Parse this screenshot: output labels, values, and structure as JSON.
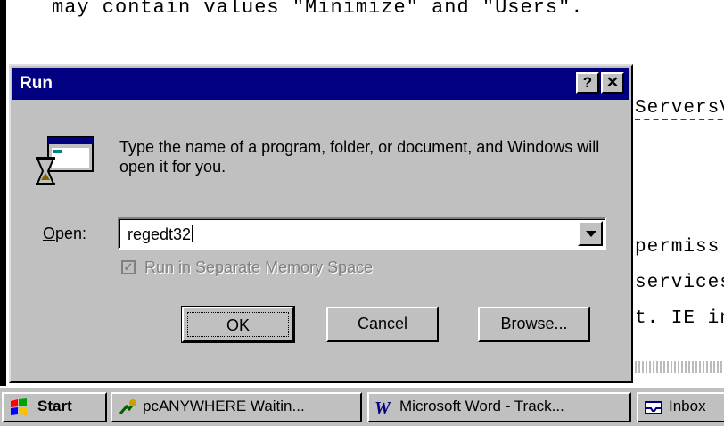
{
  "document": {
    "top_line": "may contain values \"Minimize\" and \"Users\".",
    "right_fragments": [
      "ServersV",
      "permiss",
      "services",
      "t. IE into"
    ]
  },
  "dialog": {
    "title": "Run",
    "help_button": "?",
    "close_button": "✕",
    "description": "Type the name of a program, folder, or document, and Windows will open it for you.",
    "open_label_underlined": "O",
    "open_label_rest": "pen:",
    "open_value": "regedt32",
    "checkbox_label": "Run in Separate Memory Space",
    "checkbox_checked": true,
    "checkbox_enabled": false,
    "ok_label": "OK",
    "cancel_label": "Cancel",
    "browse_label": "Browse..."
  },
  "taskbar": {
    "start": "Start",
    "items": [
      {
        "label": "pcANYWHERE Waitin...",
        "icon": "pcanywhere-icon"
      },
      {
        "label": "Microsoft Word - Track...",
        "icon": "word-icon"
      },
      {
        "label": "Inbox",
        "icon": "inbox-icon"
      }
    ]
  },
  "colors": {
    "titlebar": "#000080",
    "face": "#c0c0c0"
  }
}
